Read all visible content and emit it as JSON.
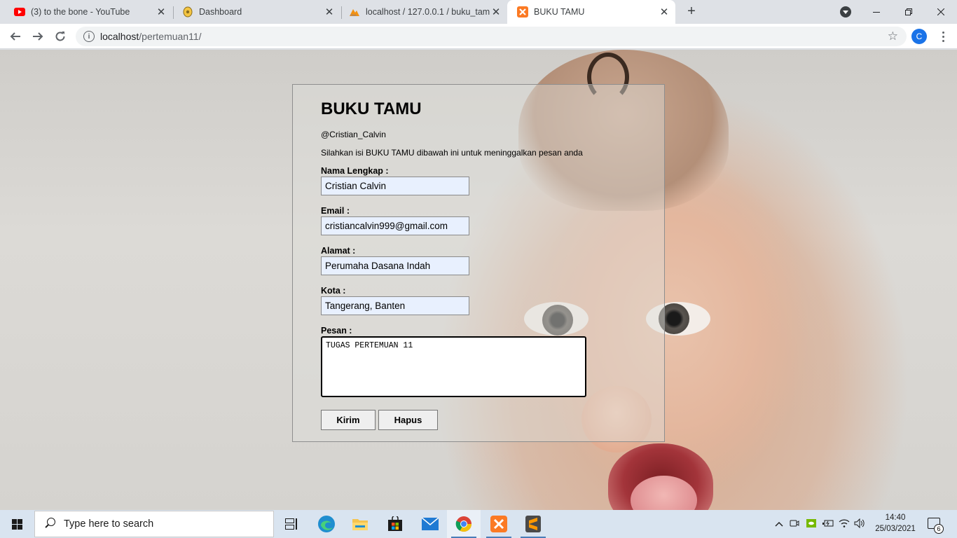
{
  "browser": {
    "tabs": [
      {
        "title": "(3) to the bone - YouTube",
        "icon": "youtube-icon"
      },
      {
        "title": "Dashboard",
        "icon": "dashboard-icon"
      },
      {
        "title": "localhost / 127.0.0.1 / buku_tamu",
        "icon": "phpmyadmin-icon"
      },
      {
        "title": "BUKU TAMU",
        "icon": "xampp-icon"
      }
    ],
    "active_tab": 3,
    "url_host": "localhost",
    "url_path": "/pertemuan11/",
    "profile_initial": "C"
  },
  "form": {
    "title": "BUKU TAMU",
    "author": "@Cristian_Calvin",
    "intro": "Silahkan isi BUKU TAMU dibawah ini untuk meninggalkan pesan anda",
    "fields": {
      "nama": {
        "label": "Nama Lengkap :",
        "value": "Cristian Calvin"
      },
      "email": {
        "label": "Email :",
        "value": "cristiancalvin999@gmail.com"
      },
      "alamat": {
        "label": "Alamat :",
        "value": "Perumaha Dasana Indah"
      },
      "kota": {
        "label": "Kota :",
        "value": "Tangerang, Banten"
      },
      "pesan": {
        "label": "Pesan :",
        "value": "TUGAS PERTEMUAN 11"
      }
    },
    "submit_label": "Kirim",
    "reset_label": "Hapus"
  },
  "taskbar": {
    "search_placeholder": "Type here to search",
    "time": "14:40",
    "date": "25/03/2021",
    "notification_count": "6",
    "accent": "#4a7db8"
  }
}
